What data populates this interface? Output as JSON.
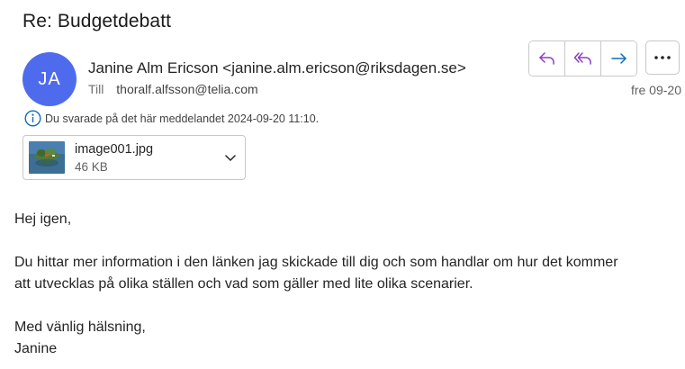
{
  "message": {
    "subject": "Re: Budgetdebatt",
    "avatar_initials": "JA",
    "avatar_color": "#4f6bed",
    "sender": "Janine Alm Ericson <janine.alm.ericson@riksdagen.se>",
    "to_label": "Till",
    "to_address": "thoralf.alfsson@telia.com",
    "date": "fre 09-20",
    "info_notice": "Du svarade på det här meddelandet 2024-09-20 11:10."
  },
  "actions": {
    "reply_icon": "reply-icon",
    "reply_all_icon": "reply-all-icon",
    "forward_icon": "forward-icon",
    "more_icon": "more-options-icon",
    "accent_color": "#0f6cbd"
  },
  "attachment": {
    "name": "image001.jpg",
    "size": "46 KB"
  },
  "body": {
    "greeting": "Hej igen,",
    "line1": "Du hittar mer information i den länken jag skickade till dig och som handlar om hur det kommer",
    "line2": "att utvecklas på olika ställen och vad som gäller med lite olika scenarier.",
    "closing": "Med vänlig hälsning,",
    "signature": "Janine"
  }
}
